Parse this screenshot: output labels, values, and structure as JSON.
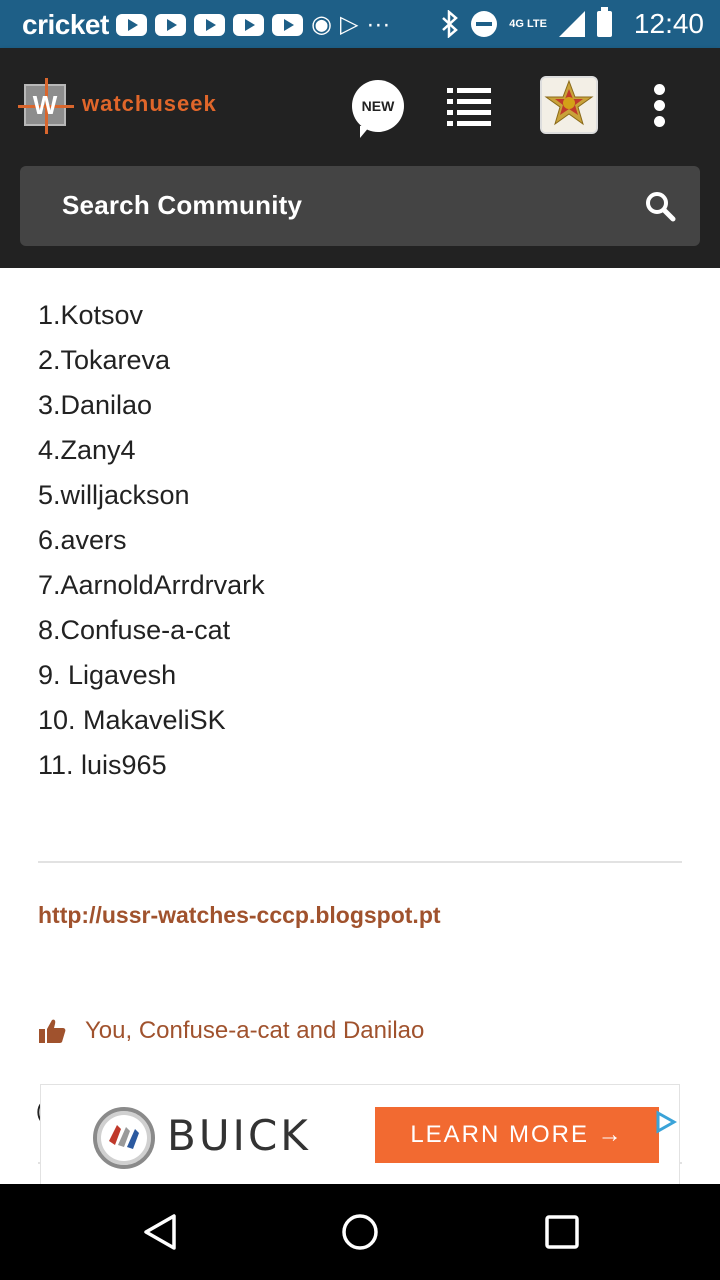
{
  "status_bar": {
    "carrier": "cricket",
    "network": "4G LTE",
    "time": "12:40",
    "icons": [
      "youtube-icon",
      "youtube-icon",
      "youtube-icon",
      "youtube-icon",
      "youtube-icon",
      "sync-icon",
      "play-store-icon",
      "more-icon",
      "bluetooth-icon",
      "do-not-disturb-icon",
      "signal-icon",
      "battery-icon"
    ]
  },
  "header": {
    "brand": "watchuseek",
    "logo_letter": "W",
    "new_label": "NEW",
    "search_placeholder": "Search Community"
  },
  "post": {
    "names": [
      "1.Kotsov",
      "2.Tokareva",
      "3.Danilao",
      "4.Zany4",
      "5.willjackson",
      "6.avers",
      "7.AarnoldArrdrvark",
      "8.Confuse-a-cat",
      "9. Ligavesh",
      "10. MakaveliSK",
      "11. luis965"
    ],
    "signature_link": "http://ussr-watches-cccp.blogspot.pt",
    "likes_text": "You, Confuse-a-cat and Danilao"
  },
  "ad": {
    "brand": "BUICK",
    "cta": "LEARN MORE  →"
  },
  "colors": {
    "status_bar": "#1e5f87",
    "header_bg": "#222222",
    "search_bg": "#444444",
    "brand_orange": "#e0662a",
    "link_brown": "#a0522d",
    "ad_cta": "#f26a31"
  }
}
